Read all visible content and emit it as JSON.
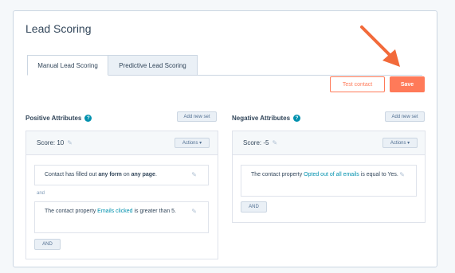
{
  "page": {
    "title": "Lead Scoring"
  },
  "tabs": [
    {
      "label": "Manual Lead Scoring",
      "active": true
    },
    {
      "label": "Predictive Lead Scoring",
      "active": false
    }
  ],
  "toolbar": {
    "test_label": "Test contact",
    "save_label": "Save"
  },
  "colors": {
    "accent": "#ff7a59",
    "link": "#0091ae",
    "text": "#33475b"
  },
  "positive": {
    "heading": "Positive Attributes",
    "add_label": "Add new set",
    "score_label": "Score: 10",
    "actions_label": "Actions",
    "rules": [
      {
        "pre": "Contact has filled out ",
        "strong": "any form",
        "mid": " on ",
        "strong2": "any page",
        "post": "."
      },
      {
        "pre": "The contact property ",
        "link": "Emails clicked",
        "post": " is greater than 5."
      }
    ],
    "joiner": "and",
    "and_button": "AND"
  },
  "negative": {
    "heading": "Negative Attributes",
    "add_label": "Add new set",
    "score_label": "Score: -5",
    "actions_label": "Actions",
    "rules": [
      {
        "pre": "The contact property ",
        "link": "Opted out of all emails",
        "post": " is equal to Yes."
      }
    ],
    "and_button": "AND"
  }
}
